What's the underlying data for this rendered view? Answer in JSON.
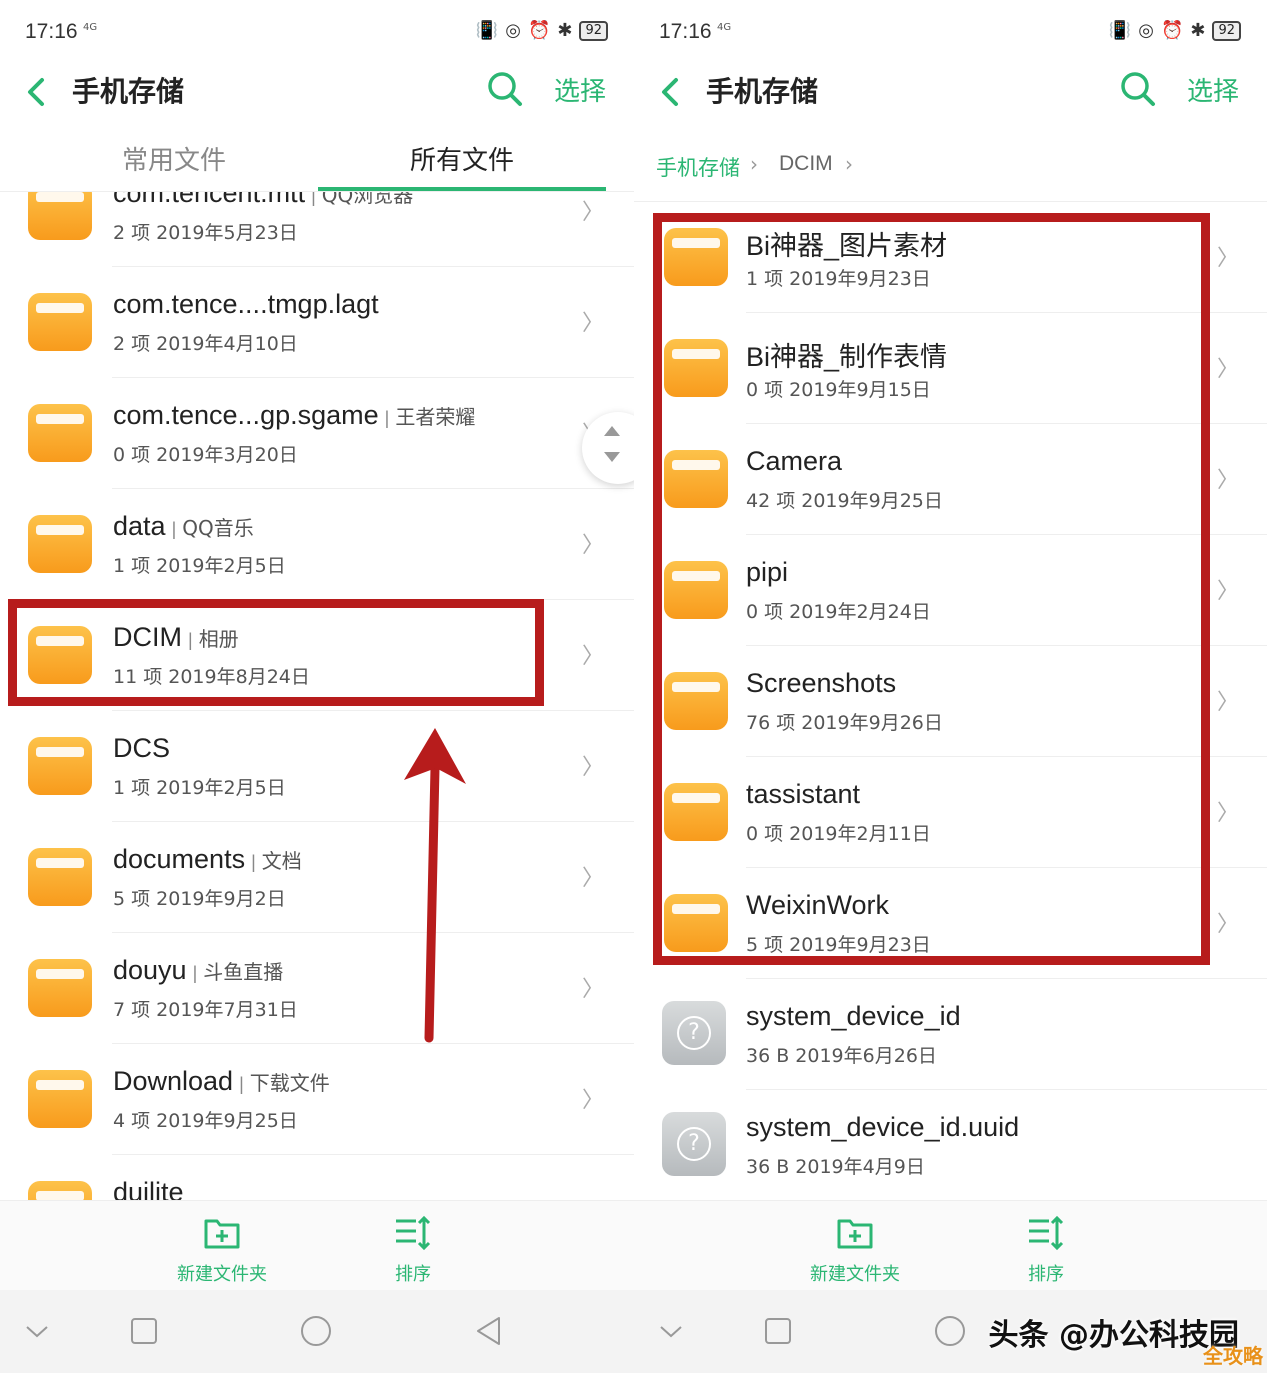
{
  "status": {
    "time": "17:16",
    "network": "4G",
    "battery": "92"
  },
  "title": "手机存储",
  "select_label": "选择",
  "tabs": {
    "common": "常用文件",
    "all": "所有文件"
  },
  "breadcrumb": {
    "root": "手机存储",
    "current": "DCIM"
  },
  "left_list": [
    {
      "name": "com.tencent.mtt",
      "tag": "QQ浏览器",
      "meta": "2 项  2019年5月23日"
    },
    {
      "name": "com.tence....tmgp.lagt",
      "tag": "",
      "meta": "2 项  2019年4月10日"
    },
    {
      "name": "com.tence...gp.sgame",
      "tag": "王者荣耀",
      "meta": "0 项  2019年3月20日"
    },
    {
      "name": "data",
      "tag": "QQ音乐",
      "meta": "1 项  2019年2月5日"
    },
    {
      "name": "DCIM",
      "tag": "相册",
      "meta": "11 项  2019年8月24日"
    },
    {
      "name": "DCS",
      "tag": "",
      "meta": "1 项  2019年2月5日"
    },
    {
      "name": "documents",
      "tag": "文档",
      "meta": "5 项  2019年9月2日"
    },
    {
      "name": "douyu",
      "tag": "斗鱼直播",
      "meta": "7 项  2019年7月31日"
    },
    {
      "name": "Download",
      "tag": "下载文件",
      "meta": "4 项  2019年9月25日"
    },
    {
      "name": "duilite",
      "tag": "",
      "meta": ""
    }
  ],
  "right_list": [
    {
      "name": "Bi神器_图片素材",
      "meta": "1 项  2019年9月23日"
    },
    {
      "name": "Bi神器_制作表情",
      "meta": "0 项  2019年9月15日"
    },
    {
      "name": "Camera",
      "meta": "42 项  2019年9月25日"
    },
    {
      "name": "pipi",
      "meta": "0 项  2019年2月24日"
    },
    {
      "name": "Screenshots",
      "meta": "76 项  2019年9月26日"
    },
    {
      "name": "tassistant",
      "meta": "0 项  2019年2月11日"
    },
    {
      "name": "WeixinWork",
      "meta": "5 项  2019年9月23日"
    }
  ],
  "right_files": [
    {
      "name": "system_device_id",
      "meta": "36 B  2019年6月26日"
    },
    {
      "name": "system_device_id.uuid",
      "meta": "36 B  2019年4月9日"
    }
  ],
  "actions": {
    "new_folder": "新建文件夹",
    "sort": "排序"
  },
  "watermark": "头条 @办公科技园",
  "corner_mark": "全攻略",
  "colors": {
    "accent": "#2bb673",
    "highlight": "#b71c1c",
    "folder": "#f9a825"
  }
}
